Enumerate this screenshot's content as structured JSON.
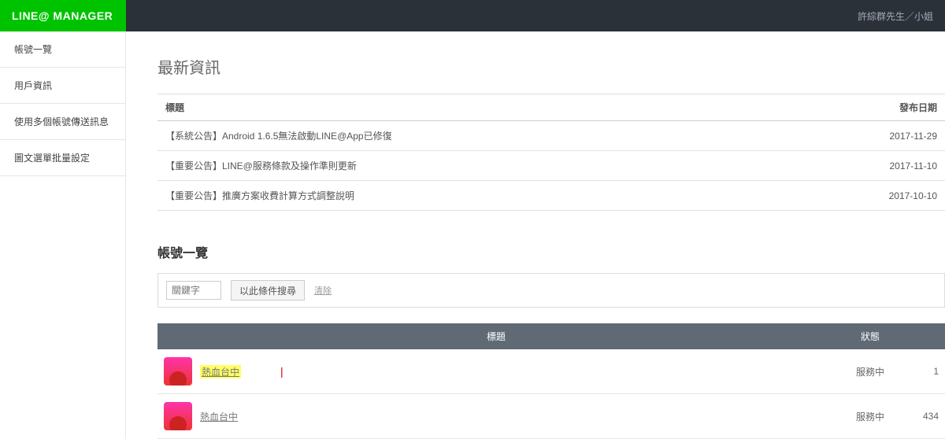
{
  "header": {
    "logo": "LINE@ MANAGER",
    "user": "許綜群先生／小姐"
  },
  "sidebar": {
    "items": [
      "帳號一覽",
      "用戶資訊",
      "使用多個帳號傳送訊息",
      "圖文選單批量設定"
    ]
  },
  "news": {
    "title": "最新資訊",
    "columns": {
      "title": "標題",
      "date": "發布日期"
    },
    "rows": [
      {
        "title": "【系統公告】Android 1.6.5無法啟動LINE@App已修復",
        "date": "2017-11-29"
      },
      {
        "title": "【重要公告】LINE@服務條款及操作準則更新",
        "date": "2017-11-10"
      },
      {
        "title": "【重要公告】推廣方案收費計算方式調整說明",
        "date": "2017-10-10"
      }
    ]
  },
  "accounts": {
    "title": "帳號一覽",
    "search": {
      "placeholder": "關鍵字",
      "button": "以此條件搜尋",
      "clear": "清除"
    },
    "columns": {
      "title": "標題",
      "status": "狀態",
      "num": ""
    },
    "rows": [
      {
        "name": "熱血台中",
        "highlight": true,
        "mark": "|",
        "status": "服務中",
        "num": "1"
      },
      {
        "name": "熱血台中",
        "highlight": false,
        "mark": "",
        "status": "服務中",
        "num": "434"
      }
    ]
  }
}
